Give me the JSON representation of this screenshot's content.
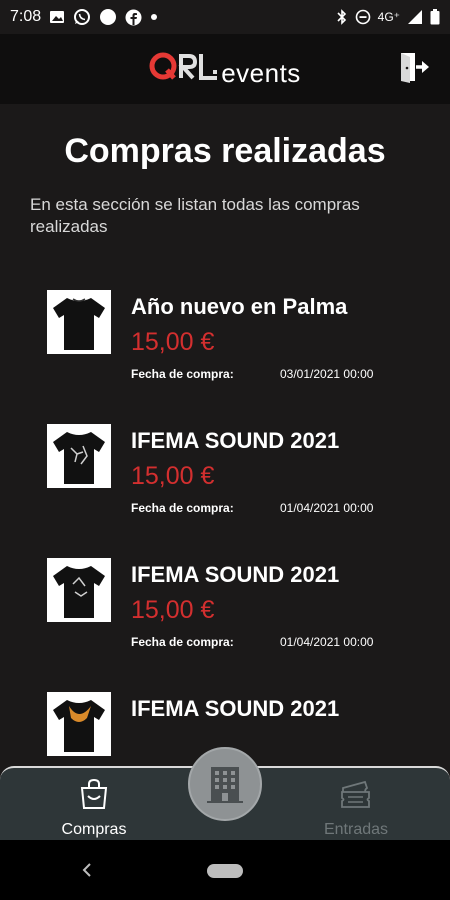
{
  "status_bar": {
    "time": "7:08",
    "network": "4G⁺"
  },
  "header": {
    "logo_text": "events",
    "logo_mark": "QRL"
  },
  "page": {
    "title": "Compras realizadas",
    "description": "En esta sección se listan todas las compras realizadas"
  },
  "purchases": [
    {
      "title": "Año nuevo en Palma",
      "price": "15,00 €",
      "date_label": "Fecha de compra:",
      "date": "03/01/2021 00:00"
    },
    {
      "title": "IFEMA SOUND 2021",
      "price": "15,00 €",
      "date_label": "Fecha de compra:",
      "date": "01/04/2021 00:00"
    },
    {
      "title": "IFEMA SOUND 2021",
      "price": "15,00 €",
      "date_label": "Fecha de compra:",
      "date": "01/04/2021 00:00"
    },
    {
      "title": "IFEMA SOUND 2021"
    }
  ],
  "bottom_nav": {
    "compras_label": "Compras",
    "entradas_label": "Entradas"
  },
  "colors": {
    "background": "#1b1919",
    "price": "#d32f2f",
    "nav_bar": "#2e3638",
    "accent_logo": "#e53935"
  }
}
